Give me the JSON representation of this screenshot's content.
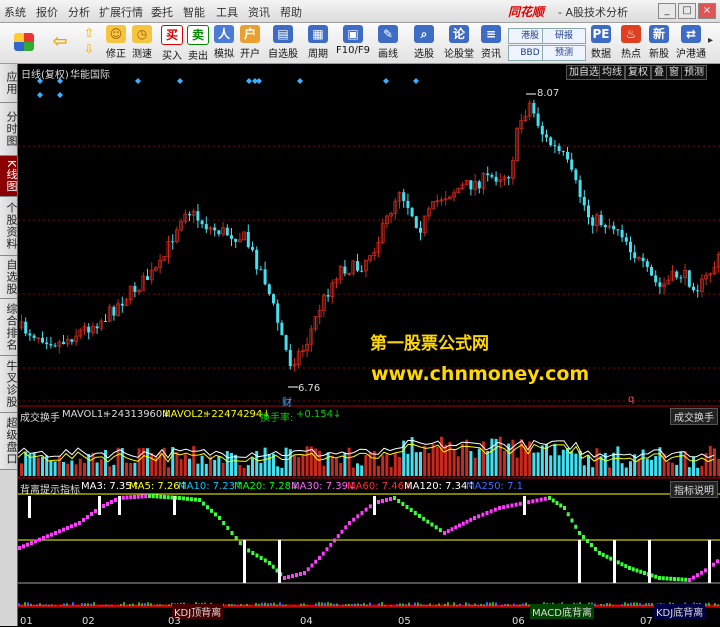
{
  "menu": {
    "items": [
      "系统",
      "报价",
      "分析",
      "扩展行情",
      "委托",
      "智能",
      "工具",
      "资讯",
      "帮助"
    ],
    "brand": "同花顺",
    "subtitle": "- A股技术分析"
  },
  "toolbar": {
    "buttons": [
      "修正",
      "测速",
      "买入",
      "卖出",
      "模拟",
      "开户",
      "自选股",
      "周期",
      "F10/F9",
      "画线",
      "选股",
      "论股堂",
      "资讯",
      "数据",
      "热点",
      "新股",
      "沪港通"
    ],
    "small_buttons": [
      "港股",
      "研报",
      "BBD",
      "预测"
    ]
  },
  "sidebar": {
    "tabs": [
      "应用",
      "分时图",
      "K线图",
      "个股资料",
      "自选股",
      "综合排名",
      "牛叉诊股",
      "超级盘口"
    ]
  },
  "chart": {
    "header_left": "日线(复权)",
    "stock_name": "华能国际",
    "right_buttons": [
      "加自选",
      "均线",
      "复权",
      "叠",
      "窗",
      "预测"
    ],
    "high_label": "8.07",
    "low_label": "6.76",
    "cai_label": "财",
    "q_label": "q"
  },
  "volume": {
    "title": "成交换手",
    "mavol1_label": "MAVOL1:",
    "mavol1_value": "+24313960↓",
    "mavol2_label": "MAVOL2:",
    "mavol2_value": "+22474294↓",
    "turnover_label": "换手率:",
    "turnover_value": "+0.154↓",
    "right_label": "成交换手"
  },
  "indicator": {
    "title": "背离提示指标",
    "ma": [
      {
        "label": "MA3: 7.35↑",
        "color": "#ffffff"
      },
      {
        "label": "MA5: 7.26↑",
        "color": "#ffff00"
      },
      {
        "label": "MA10: 7.23↑",
        "color": "#00c8ff"
      },
      {
        "label": "MA20: 7.28↓",
        "color": "#00ff00"
      },
      {
        "label": "MA30: 7.39↓",
        "color": "#ff66ff"
      },
      {
        "label": "MA60: 7.46↓",
        "color": "#ff3030"
      },
      {
        "label": "MA120: 7.34↑",
        "color": "#ffffff"
      },
      {
        "label": "MA250: 7.1",
        "color": "#3c6cff"
      }
    ],
    "right_label": "指标说明",
    "bottom_labels": [
      "KDJ顶背离",
      "MACD底背离",
      "KDJ底背离"
    ]
  },
  "axis": {
    "months": [
      "01",
      "02",
      "03",
      "04",
      "05",
      "06",
      "07"
    ]
  },
  "watermark": {
    "line1": "第一股票公式网",
    "line2": "www.chnmoney.com"
  },
  "colors": {
    "up": "#c8281e",
    "down": "#44e0f0",
    "grid": "#8b0000",
    "diamond": "#3cb0ff"
  }
}
